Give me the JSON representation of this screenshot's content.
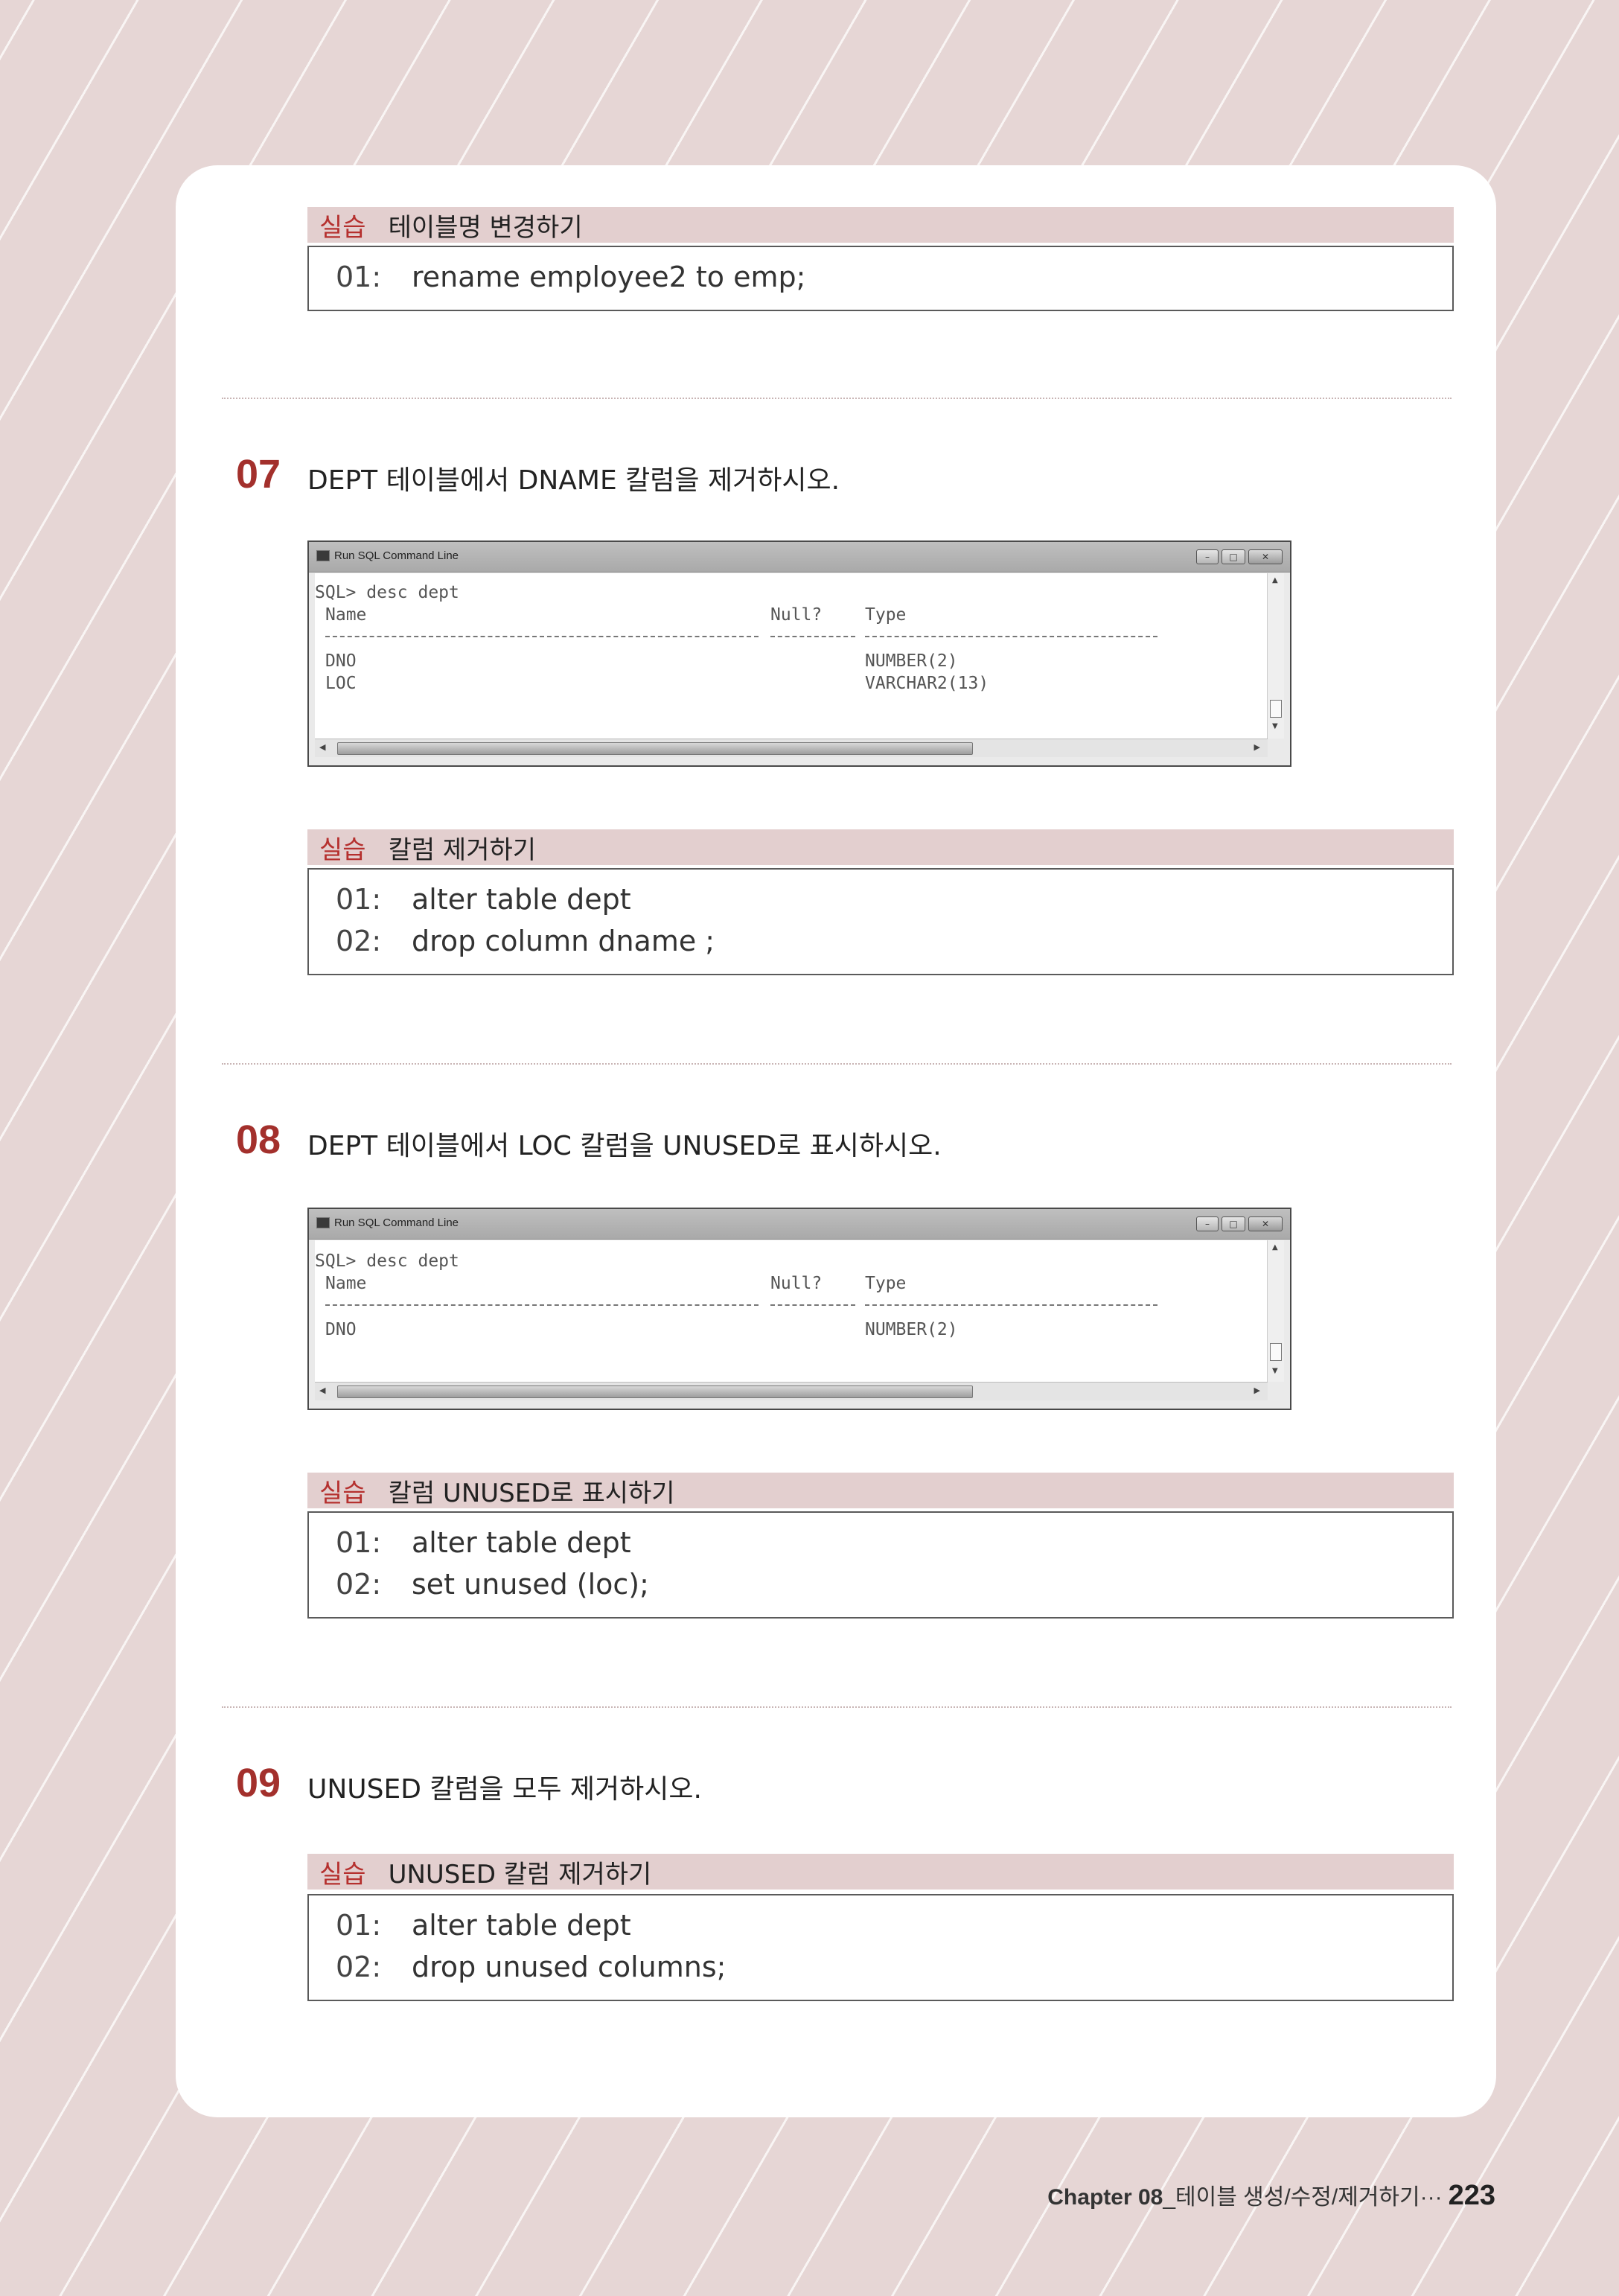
{
  "practice1": {
    "tag": "실습",
    "title": "테이블명 변경하기",
    "lines": [
      {
        "num": "01:",
        "code": "rename employee2 to emp;"
      }
    ]
  },
  "q07": {
    "number": "07",
    "text": "DEPT 테이블에서 DNAME 칼럼을 제거하시오.",
    "window": {
      "title": "Run SQL Command Line",
      "prompt": "SQL> desc dept",
      "headers": {
        "name": "Name",
        "null": "Null?",
        "type": "Type"
      },
      "rows": [
        {
          "name": "DNO",
          "type": "NUMBER(2)"
        },
        {
          "name": "LOC",
          "type": "VARCHAR2(13)"
        }
      ]
    }
  },
  "practice2": {
    "tag": "실습",
    "title": "칼럼 제거하기",
    "lines": [
      {
        "num": "01:",
        "code": "alter table dept"
      },
      {
        "num": "02:",
        "code": "drop column dname ;"
      }
    ]
  },
  "q08": {
    "number": "08",
    "text": "DEPT 테이블에서 LOC 칼럼을 UNUSED로 표시하시오.",
    "window": {
      "title": "Run SQL Command Line",
      "prompt": "SQL> desc dept",
      "headers": {
        "name": "Name",
        "null": "Null?",
        "type": "Type"
      },
      "rows": [
        {
          "name": "DNO",
          "type": "NUMBER(2)"
        }
      ]
    }
  },
  "practice3": {
    "tag": "실습",
    "title": "칼럼 UNUSED로 표시하기",
    "lines": [
      {
        "num": "01:",
        "code": "alter table dept"
      },
      {
        "num": "02:",
        "code": "set unused (loc);"
      }
    ]
  },
  "q09": {
    "number": "09",
    "text": "UNUSED 칼럼을 모두 제거하시오."
  },
  "practice4": {
    "tag": "실습",
    "title": "UNUSED 칼럼 제거하기",
    "lines": [
      {
        "num": "01:",
        "code": "alter table dept"
      },
      {
        "num": "02:",
        "code": "drop unused columns;"
      }
    ]
  },
  "footer": {
    "chapter": "Chapter 08",
    "subtitle": "_테이블 생성/수정/제거하기···",
    "page": "223"
  },
  "colors": {
    "accent": "#a3302c",
    "header_band": "#e3cfcf",
    "background": "#e6d6d5"
  }
}
